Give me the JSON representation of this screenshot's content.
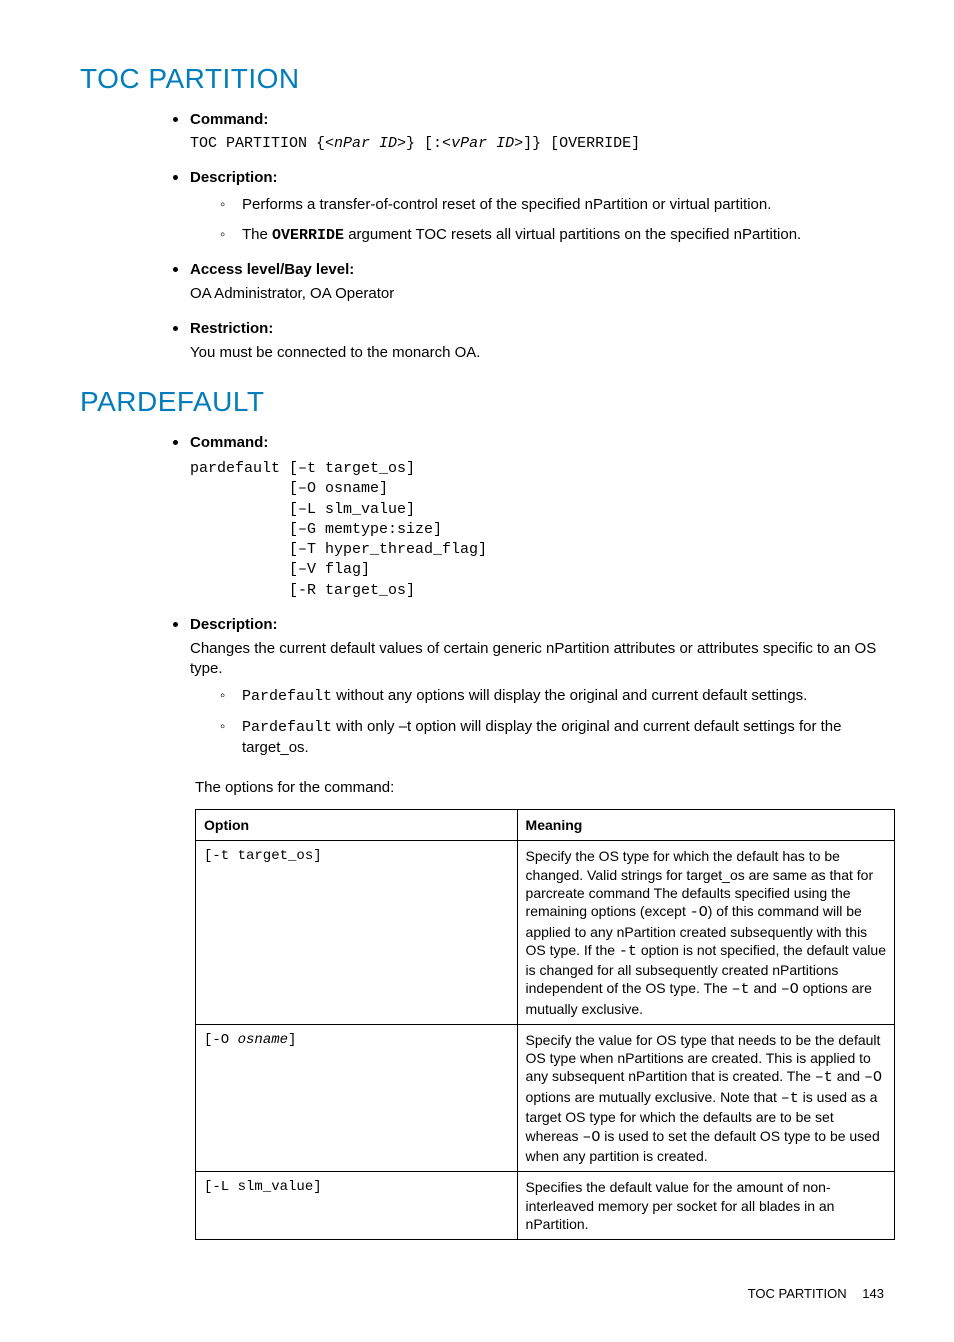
{
  "section1": {
    "title": "TOC PARTITION",
    "command_label": "Command:",
    "command_pre": "TOC PARTITION {<",
    "command_npar": "nPar ID",
    "command_mid": ">} [:<",
    "command_vpar": "vPar ID",
    "command_post": ">]} [OVERRIDE]",
    "description_label": "Description:",
    "desc1": "Performs a transfer-of-control reset of the specified nPartition or virtual partition.",
    "desc2_pre": "The ",
    "desc2_code": "OVERRIDE",
    "desc2_post": " argument TOC resets all virtual partitions on the specified nPartition.",
    "access_label": "Access level/Bay level:",
    "access_value": "OA Administrator, OA Operator",
    "restriction_label": "Restriction:",
    "restriction_value": "You must be connected to the monarch OA."
  },
  "section2": {
    "title": "PARDEFAULT",
    "command_label": "Command:",
    "command_text": "pardefault [–t target_os]\n           [–O osname]\n           [–L slm_value]\n           [–G memtype:size]\n           [–T hyper_thread_flag]\n           [–V flag]\n           [-R target_os]",
    "description_label": "Description:",
    "desc_intro": "Changes the current default values of certain generic nPartition attributes or attributes specific to an OS type.",
    "d1_code": "Pardefault",
    "d1_text": " without any options will display the original and current default settings.",
    "d2_code": "Pardefault",
    "d2_text": " with only –t option will display the original and current default settings for the target_os.",
    "options_intro": "The options for the command:",
    "table": {
      "h1": "Option",
      "h2": "Meaning",
      "rows": [
        {
          "opt": "[-t target_os]",
          "mean_pre": "Specify the OS type for which the default has to be changed. Valid strings for target_os are same as that for parcreate command The defaults specified using the remaining options (except ",
          "c1": "-O",
          "mean_mid1": ") of this command will be applied to any nPartition created subsequently with this OS type. If the ",
          "c2": "-t",
          "mean_mid2": " option is not specified, the default value is changed for all subsequently created nPartitions independent of the OS type. The ",
          "c3": "–t",
          "mean_mid3": " and ",
          "c4": "–O",
          "mean_post": " options are mutually exclusive."
        },
        {
          "opt_pre": "[-O ",
          "opt_it": "osname",
          "opt_post": "]",
          "mean_pre": "Specify the value for OS type that needs to be the default OS type when nPartitions are created. This is applied to any subsequent nPartition that is created. The ",
          "c1": "–t",
          "mean_mid1": " and ",
          "c2": "–O",
          "mean_mid2": " options are mutually exclusive. Note that ",
          "c3": "–t",
          "mean_mid3": " is used as a target OS type for which the defaults are to be set whereas ",
          "c4": "–O",
          "mean_post": " is used to set the default OS type to be used when any partition is created."
        },
        {
          "opt": "[-L slm_value]",
          "mean": "Specifies the default value for the amount of non-interleaved memory per socket for all blades in an nPartition."
        }
      ]
    }
  },
  "footer": {
    "title": "TOC PARTITION",
    "page": "143"
  }
}
